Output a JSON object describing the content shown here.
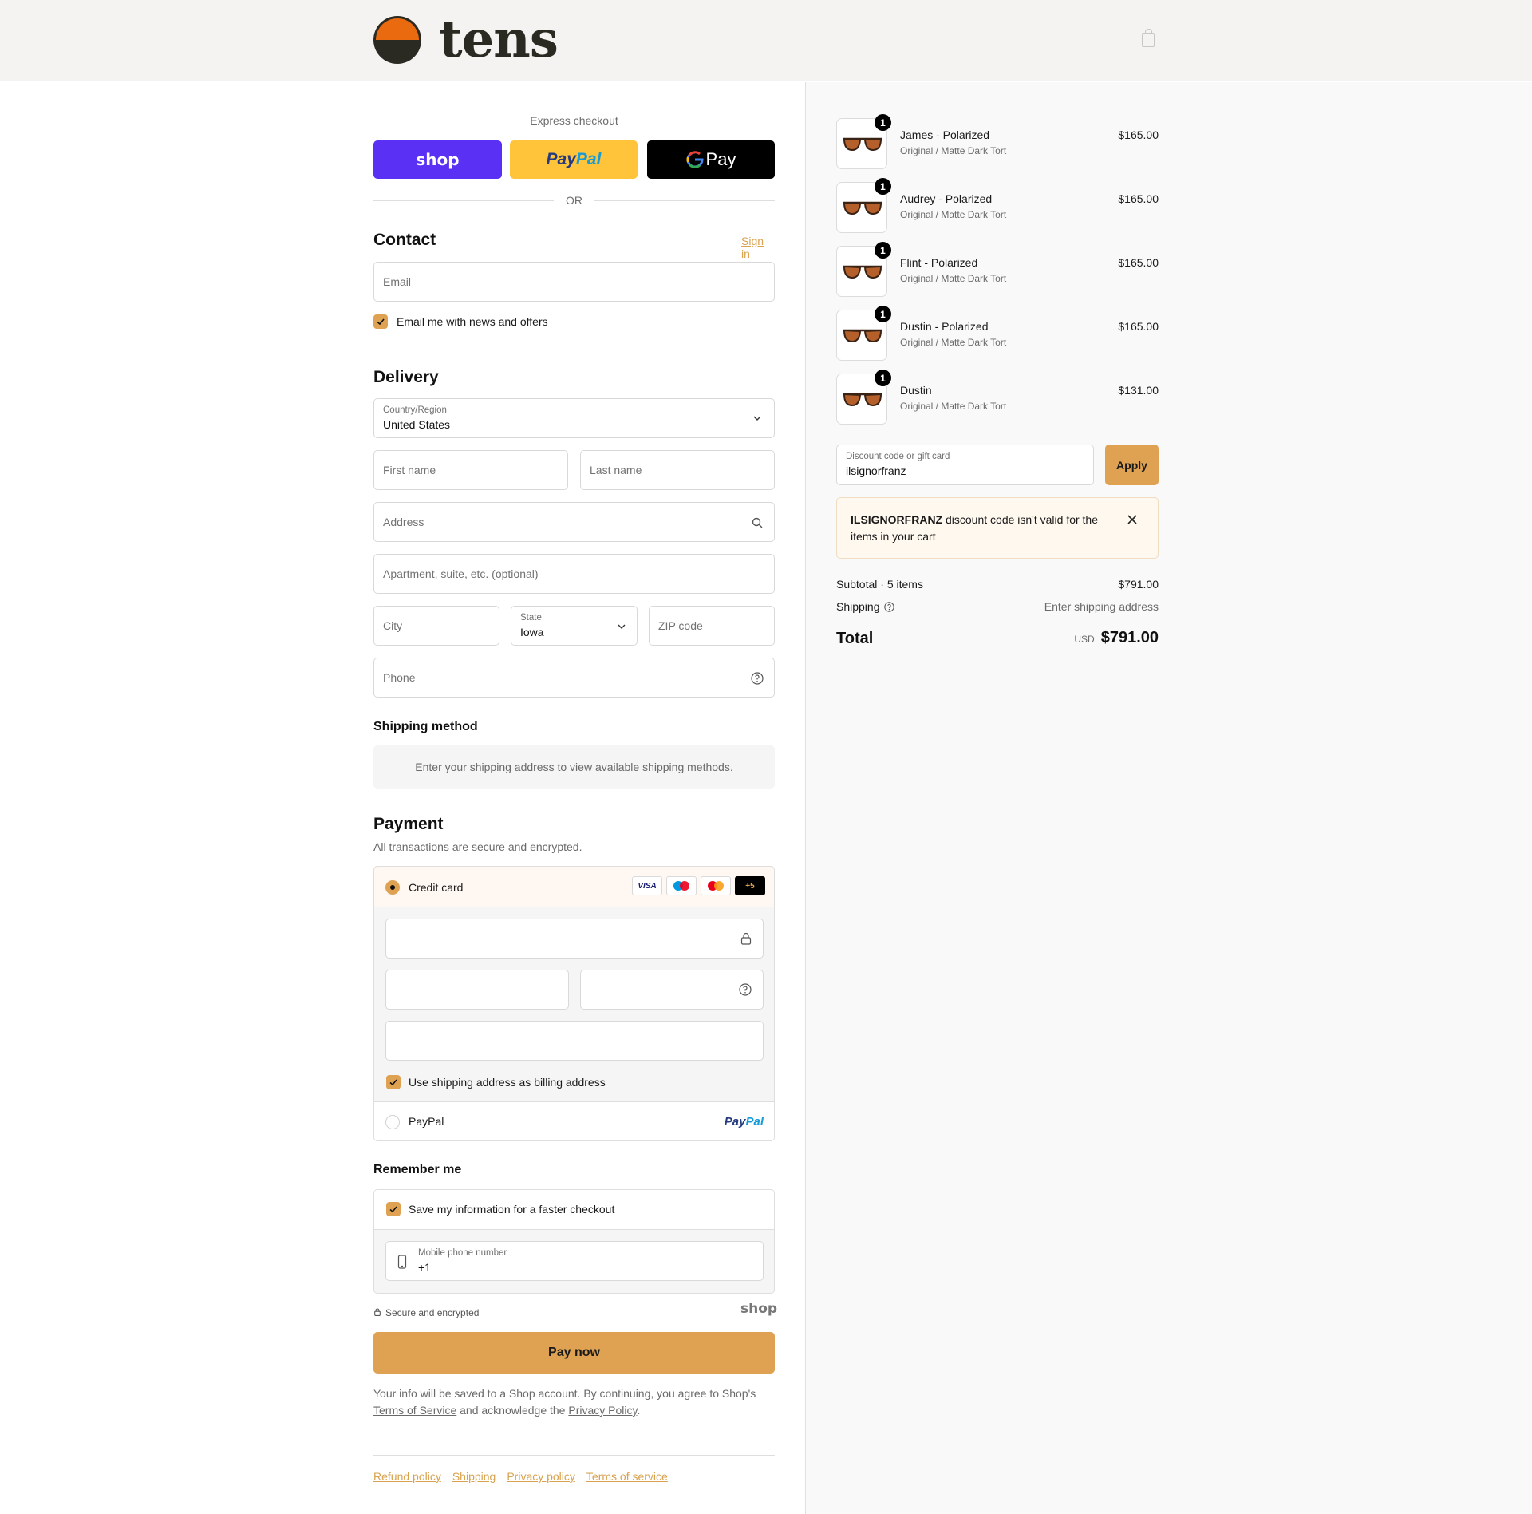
{
  "brand": {
    "name": "tens"
  },
  "express": {
    "title": "Express checkout",
    "shop_label": "shop",
    "paypal_label_1": "Pay",
    "paypal_label_2": "Pal",
    "gpay_label": "Pay",
    "or_label": "OR"
  },
  "contact": {
    "title": "Contact",
    "sign_in": "Sign in",
    "email_placeholder": "Email",
    "newsletter_label": "Email me with news and offers"
  },
  "delivery": {
    "title": "Delivery",
    "country_label": "Country/Region",
    "country_value": "United States",
    "first_name": "First name",
    "last_name": "Last name",
    "address": "Address",
    "apartment": "Apartment, suite, etc. (optional)",
    "city": "City",
    "state_label": "State",
    "state_value": "Iowa",
    "zip": "ZIP code",
    "phone": "Phone"
  },
  "shipping_method": {
    "title": "Shipping method",
    "notice": "Enter your shipping address to view available shipping methods."
  },
  "payment": {
    "title": "Payment",
    "subtitle": "All transactions are secure and encrypted.",
    "credit_card_label": "Credit card",
    "visa": "VISA",
    "more_cards": "+5",
    "billing_label": "Use shipping address as billing address",
    "paypal_label": "PayPal"
  },
  "remember": {
    "title": "Remember me",
    "save_label": "Save my information for a faster checkout",
    "mobile_label": "Mobile phone number",
    "mobile_value": "+1"
  },
  "secure": {
    "label": "Secure and encrypted",
    "shop_logo": "shop"
  },
  "pay_now": "Pay now",
  "legal": {
    "line1": "Your info will be saved to a Shop account. By continuing, you agree to Shop's",
    "tos": "Terms of Service",
    "middle": "and acknowledge the",
    "privacy": "Privacy Policy",
    "end": "."
  },
  "footer_links": [
    "Refund policy",
    "Shipping",
    "Privacy policy",
    "Terms of service"
  ],
  "cart": {
    "items": [
      {
        "name": "James - Polarized",
        "variant": "Original / Matte Dark Tort",
        "price": "$165.00",
        "qty": "1"
      },
      {
        "name": "Audrey - Polarized",
        "variant": "Original / Matte Dark Tort",
        "price": "$165.00",
        "qty": "1"
      },
      {
        "name": "Flint - Polarized",
        "variant": "Original / Matte Dark Tort",
        "price": "$165.00",
        "qty": "1"
      },
      {
        "name": "Dustin - Polarized",
        "variant": "Original / Matte Dark Tort",
        "price": "$165.00",
        "qty": "1"
      },
      {
        "name": "Dustin",
        "variant": "Original / Matte Dark Tort",
        "price": "$131.00",
        "qty": "1"
      }
    ],
    "discount_label": "Discount code or gift card",
    "discount_value": "ilsignorfranz",
    "apply": "Apply",
    "error_code": "ILSIGNORFRANZ",
    "error_text": "discount code isn't valid for the items in your cart",
    "subtotal_label": "Subtotal · 5 items",
    "subtotal_value": "$791.00",
    "shipping_label": "Shipping",
    "shipping_value": "Enter shipping address",
    "total_label": "Total",
    "currency": "USD",
    "total_value": "$791.00"
  },
  "colors": {
    "accent": "#dfa252",
    "shop_purple": "#5a31f4",
    "paypal_yellow": "#ffc439",
    "error_bg": "#fff8ef"
  },
  "icons": [
    "shopping-bag-icon",
    "chevron-down-icon",
    "search-icon",
    "help-circle-icon",
    "lock-icon",
    "close-icon",
    "mobile-phone-icon",
    "check-icon"
  ]
}
